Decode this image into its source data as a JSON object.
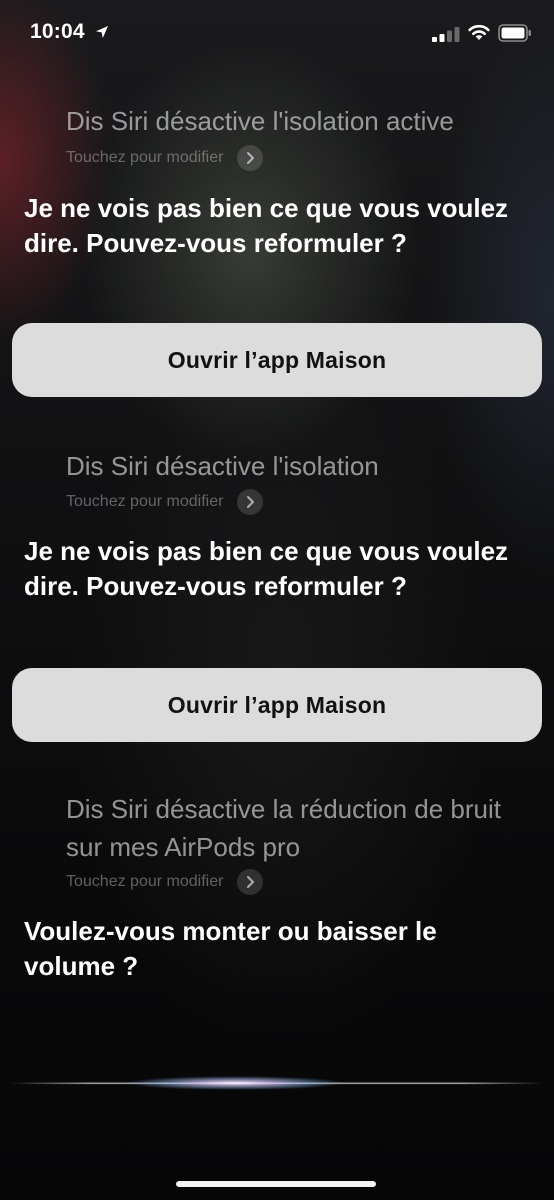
{
  "status_bar": {
    "time": "10:04"
  },
  "conversation": [
    {
      "query": "Dis Siri désactive l'isolation active",
      "edit_label": "Touchez pour modifier",
      "answer": "Je ne vois pas bien ce que vous voulez dire. Pouvez-vous reformuler ?",
      "button_label": "Ouvrir l’app Maison"
    },
    {
      "query": "Dis Siri désactive l'isolation",
      "edit_label": "Touchez pour modifier",
      "answer": "Je ne vois pas bien ce que vous voulez dire. Pouvez-vous reformuler ?",
      "button_label": "Ouvrir l’app Maison"
    },
    {
      "query": "Dis Siri désactive la réduction de bruit sur mes AirPods pro",
      "edit_label": "Touchez pour modifier",
      "answer": "Voulez-vous monter ou baisser le volume ?"
    }
  ],
  "icons": {
    "status": [
      "location-arrow-icon",
      "cellular-signal-icon",
      "wifi-icon",
      "battery-icon"
    ],
    "chevron": "chevron-right-icon"
  },
  "colors": {
    "button_bg": "#dcdcdc",
    "background": "#0b0b0c"
  }
}
